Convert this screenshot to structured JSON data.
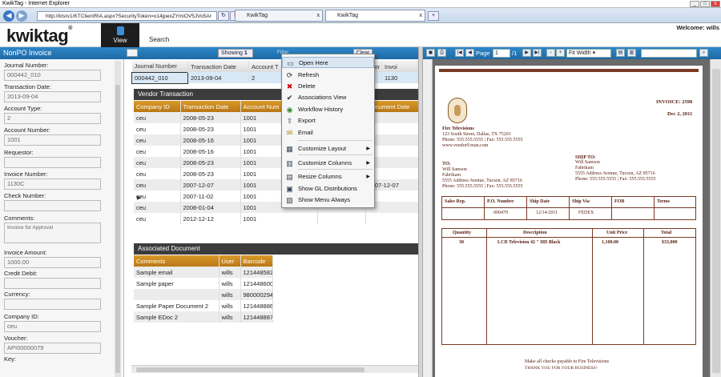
{
  "window": {
    "title": "KwikTag - Internet Explorer"
  },
  "ie": {
    "url": "http://ktsrv1/KTClientRIA.aspx?SecurityToken=o14jpexZYmiOV5JVo5Ar",
    "tabs": [
      {
        "label": "KwikTag"
      },
      {
        "label": "KwikTag"
      }
    ]
  },
  "app": {
    "logo": "kwiktag",
    "tabs": {
      "view": "View",
      "search": "Search"
    },
    "welcome": "Welcome: wills"
  },
  "left_panel": {
    "title": "NonPO Invoice",
    "fields": [
      {
        "label": "Journal Number:",
        "value": "000442_010"
      },
      {
        "label": "Transaction Date:",
        "value": "2013-09-04"
      },
      {
        "label": "Account Type:",
        "value": "2"
      },
      {
        "label": "Account Number:",
        "value": "1001"
      },
      {
        "label": "Requestor:",
        "value": ""
      },
      {
        "label": "Invoice Number:",
        "value": "1130C"
      },
      {
        "label": "Check Number:",
        "value": ""
      },
      {
        "label": "Comments:",
        "value": "Invoice for Approval"
      },
      {
        "label": "Invoice Amount:",
        "value": "1000.00"
      },
      {
        "label": "Credit Debit:",
        "value": ""
      },
      {
        "label": "Currency:",
        "value": ""
      },
      {
        "label": "Company ID:",
        "value": "ceu"
      },
      {
        "label": "Voucher:",
        "value": "API00000079"
      },
      {
        "label": "Key:",
        "value": ""
      }
    ]
  },
  "toolbar": {
    "showing_label": "Showing",
    "showing_value": "1",
    "filter_label": "Filter",
    "clear_label": "Clear"
  },
  "main_grid": {
    "headers": [
      "Journal Number",
      "Transaction Date",
      "Account T",
      "equestor",
      "Invoi"
    ],
    "row": [
      "000442_010",
      "2013-09-04",
      "2",
      "",
      "1130"
    ]
  },
  "vendor_section": {
    "title": "Vendor Transaction",
    "headers": [
      "Company ID",
      "Transaction Date",
      "Account Num",
      "",
      "Document Date"
    ],
    "rows": [
      [
        "ceu",
        "2008-05-23",
        "1001",
        ""
      ],
      [
        "ceu",
        "2008-05-23",
        "1001",
        ""
      ],
      [
        "ceu",
        "2008-05-16",
        "1001",
        ""
      ],
      [
        "ceu",
        "2008-05-16",
        "1001",
        ""
      ],
      [
        "ceu",
        "2008-05-23",
        "1001",
        ""
      ],
      [
        "ceu",
        "2008-05-23",
        "1001",
        ""
      ],
      [
        "ceu",
        "2007-12-07",
        "1001",
        "2007-12-07"
      ],
      [
        "ceu",
        "2007-11-02",
        "1001",
        ""
      ],
      [
        "ceu",
        "2008-01-04",
        "1001",
        ""
      ],
      [
        "ceu",
        "2012-12-12",
        "1001",
        ""
      ]
    ]
  },
  "assoc_section": {
    "title": "Associated Document",
    "headers": [
      "Comments",
      "User",
      "Barcode"
    ],
    "rows": [
      [
        "Sample email",
        "wills",
        "121448582"
      ],
      [
        "Sample paper",
        "wills",
        "121448600"
      ],
      [
        "",
        "wills",
        "980000294"
      ],
      [
        "Sample Paper Document 2",
        "wills",
        "121448886"
      ],
      [
        "Sample EDoc 2",
        "wills",
        "121448887"
      ]
    ]
  },
  "context_menu": {
    "items": [
      {
        "label": "Open Here",
        "icon": "open-here-icon"
      },
      {
        "label": "Refresh",
        "icon": "refresh-icon"
      },
      {
        "label": "Delete",
        "icon": "delete-icon"
      },
      {
        "label": "Associations View",
        "icon": "checkmark-icon"
      },
      {
        "label": "Workflow History",
        "icon": "workflow-icon"
      },
      {
        "label": "Export",
        "icon": "export-icon"
      },
      {
        "label": "Email",
        "icon": "email-icon"
      },
      {
        "label": "Customize Layout",
        "icon": "layout-icon"
      },
      {
        "label": "Customize Columns",
        "icon": "columns-icon"
      },
      {
        "label": "Resize Columns",
        "icon": "resize-icon"
      },
      {
        "label": "Show GL Distributions",
        "icon": "gl-icon"
      },
      {
        "label": "Show Menu Always",
        "icon": "menu-icon"
      }
    ]
  },
  "viewer": {
    "page_label": "Page",
    "page_value": "1",
    "page_total": "/1",
    "zoom": "Fit Width"
  },
  "document": {
    "invoice_no": "INVOICE: 2598",
    "date": "Dec 2, 2011",
    "company": "Fire Televisions",
    "address": "123 South Street, Dallas, TX 75201",
    "phone": "Phone: 555.555.5555 | Fax: 555.555.5555",
    "web": "www.vendor9.man.com",
    "ship_to_label": "SHIP TO:",
    "ship_to": [
      "Will Samson",
      "Fabrikam",
      "5555 Address Avenue, Tucson, AZ 85716",
      "Phone: 555.555.5555 | Fax: 555.555.5555"
    ],
    "to_label": "TO:",
    "to": [
      "Will Samson",
      "Fabrikam",
      "5555 Address Avenue, Tucson, AZ 85716",
      "Phone: 555.555.5555 | Fax: 555.555.5555"
    ],
    "order_headers": [
      "Sales Rep.",
      "P.O. Number",
      "Ship Date",
      "Ship Via",
      "FOB",
      "Terms"
    ],
    "order_values": [
      "",
      "000479",
      "12/14/2011",
      "FEDEX",
      "",
      ""
    ],
    "item_headers": [
      "Quantity",
      "Description",
      "Unit Price",
      "Total"
    ],
    "item_row": [
      "30",
      "LCD Television 42 \" HD Black",
      "1,100.00",
      "$33,000"
    ],
    "footer": "Make all checks payable to Fire Televisions",
    "footer2": "THANK YOU FOR YOUR BUSINESS!"
  }
}
